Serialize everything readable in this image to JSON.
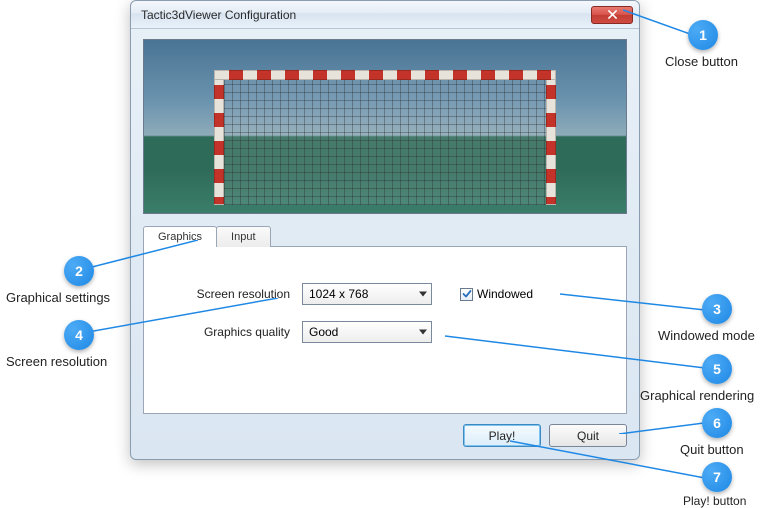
{
  "window": {
    "title": "Tactic3dViewer Configuration"
  },
  "tabs": {
    "graphics_label": "Graphics",
    "input_label": "Input"
  },
  "form": {
    "resolution_label": "Screen resolution",
    "quality_label": "Graphics quality",
    "windowed_label": "Windowed",
    "resolution_value": "1024 x 768",
    "quality_value": "Good",
    "windowed_checked": true
  },
  "buttons": {
    "play_label": "Play!",
    "quit_label": "Quit"
  },
  "annotations": {
    "a1": {
      "num": "1",
      "label": "Close button"
    },
    "a2": {
      "num": "2",
      "label": "Graphical settings"
    },
    "a3": {
      "num": "3",
      "label": "Windowed mode"
    },
    "a4": {
      "num": "4",
      "label": "Screen resolution"
    },
    "a5": {
      "num": "5",
      "label": "Graphical rendering"
    },
    "a6": {
      "num": "6",
      "label": "Quit button"
    },
    "a7": {
      "num": "7",
      "label": "Play! button"
    }
  }
}
